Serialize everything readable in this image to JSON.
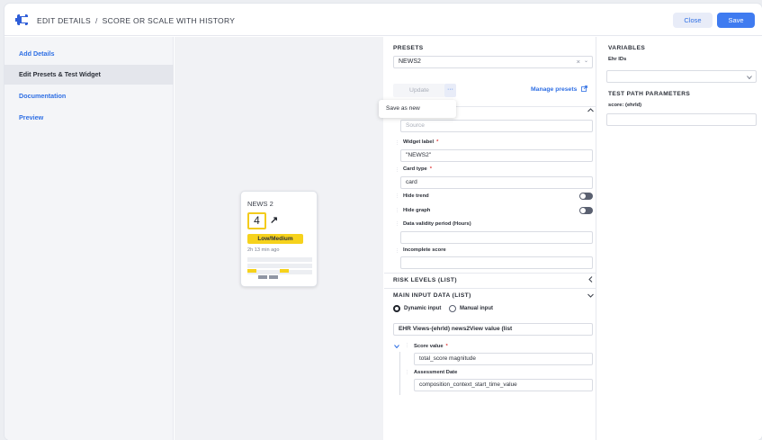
{
  "header": {
    "breadcrumb_root": "EDIT DETAILS",
    "breadcrumb_sep": "/",
    "breadcrumb_current": "SCORE OR SCALE WITH HISTORY",
    "close_label": "Close",
    "save_label": "Save"
  },
  "nav": {
    "items": [
      {
        "label": "Add Details"
      },
      {
        "label": "Edit Presets & Test Widget"
      },
      {
        "label": "Documentation"
      },
      {
        "label": "Preview"
      }
    ]
  },
  "card": {
    "title": "NEWS 2",
    "score": "4",
    "trend_glyph": "↗",
    "risk_label": "Low/Medium",
    "time": "2h 13 min ago",
    "accent_color": "#f3cb1c"
  },
  "presets": {
    "heading": "PRESETS",
    "selected": "NEWS2",
    "clear_glyph": "×",
    "chevron_glyph": "⌄",
    "update_label": "Update",
    "more_glyph": "···",
    "manage_label": "Manage presets",
    "menu_item": "Save as new",
    "source_placeholder": "Source",
    "widget_label_label": "Widget label",
    "widget_label_value": "\"NEWS2\"",
    "card_type_label": "Card type",
    "card_type_value": "card",
    "hide_trend_label": "Hide trend",
    "hide_graph_label": "Hide graph",
    "validity_label": "Data validity period (Hours)",
    "incomplete_label": "Incomplete score",
    "required_mark": "*",
    "risk_levels_heading": "RISK LEVELS (LIST)",
    "main_input_heading": "MAIN INPUT DATA (LIST)",
    "dynamic_input_label": "Dynamic input",
    "manual_input_label": "Manual input",
    "ehr_view_value": "EHR Views-(ehrId) news2View value (list",
    "score_value_label": "Score value",
    "score_value_value": "total_score magnitude",
    "assessment_date_label": "Assessment Date",
    "assessment_date_value": "composition_context_start_time_value"
  },
  "variables": {
    "heading": "VARIABLES",
    "ehr_ids_label": "Ehr IDs",
    "test_path_heading": "TEST PATH PARAMETERS",
    "score_param_label": "score: (ehrId)"
  }
}
